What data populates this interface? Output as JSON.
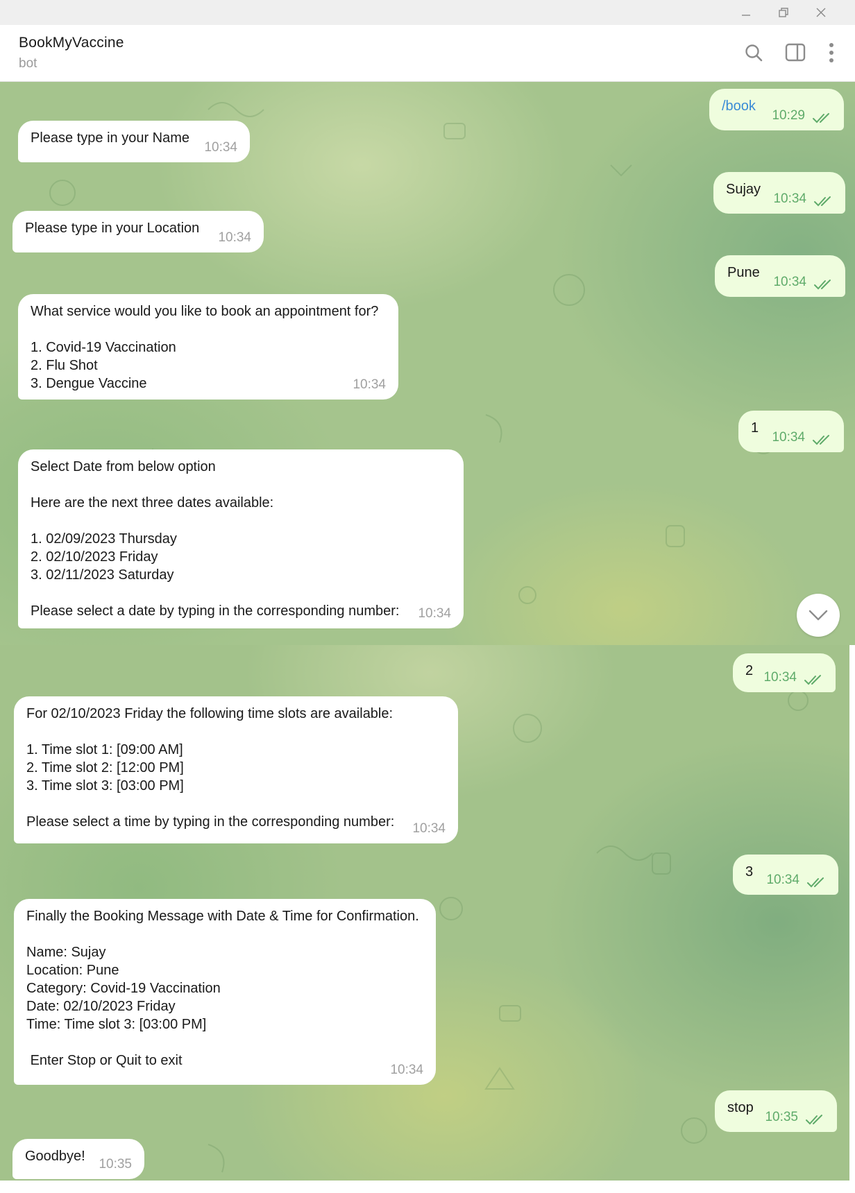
{
  "window": {
    "controls": [
      "minimize",
      "restore",
      "close"
    ]
  },
  "header": {
    "title": "BookMyVaccine",
    "subtitle": "bot",
    "icons": [
      "search-icon",
      "sidebar-toggle-icon",
      "more-vert-icon"
    ]
  },
  "messages": [
    {
      "dir": "out",
      "text": "/book",
      "time": "10:29",
      "is_command": true
    },
    {
      "dir": "in",
      "text": "Please type in your Name",
      "time": "10:34"
    },
    {
      "dir": "out",
      "text": "Sujay",
      "time": "10:34"
    },
    {
      "dir": "in",
      "text": "Please type in your Location",
      "time": "10:34"
    },
    {
      "dir": "out",
      "text": "Pune",
      "time": "10:34"
    },
    {
      "dir": "in",
      "text": "What service would you like to book an appointment for?\n\n1. Covid-19 Vaccination\n2. Flu Shot\n3. Dengue Vaccine",
      "time": "10:34"
    },
    {
      "dir": "out",
      "text": "1",
      "time": "10:34"
    },
    {
      "dir": "in",
      "text": "Select Date from below option\n\nHere are the next three dates available:\n\n1. 02/09/2023 Thursday\n2. 02/10/2023 Friday\n3. 02/11/2023 Saturday\n\nPlease select a date by typing in the corresponding number:",
      "time": "10:34"
    },
    {
      "dir": "out",
      "text": "2",
      "time": "10:34"
    },
    {
      "dir": "in",
      "text": "For 02/10/2023 Friday the following time slots are available:\n\n1. Time slot 1: [09:00 AM]\n2. Time slot 2: [12:00 PM]\n3. Time slot 3: [03:00 PM]\n\nPlease select a time by typing in the corresponding number:",
      "time": "10:34"
    },
    {
      "dir": "out",
      "text": "3",
      "time": "10:34"
    },
    {
      "dir": "in",
      "text": "Finally the Booking Message with Date & Time for Confirmation.\n\nName: Sujay\nLocation: Pune\nCategory: Covid-19 Vaccination\nDate: 02/10/2023 Friday\nTime: Time slot 3: [03:00 PM]\n\n Enter Stop or Quit to exit",
      "time": "10:34"
    },
    {
      "dir": "out",
      "text": "stop",
      "time": "10:35"
    },
    {
      "dir": "in",
      "text": "Goodbye!",
      "time": "10:35"
    }
  ],
  "scroll_button": {
    "icon": "chevron-down-icon"
  },
  "colors": {
    "incoming_bubble": "#ffffff",
    "outgoing_bubble": "#effdde",
    "outgoing_time": "#5fab6a",
    "command_link": "#3a8bd6",
    "wallpaper": "#a5c48d"
  }
}
